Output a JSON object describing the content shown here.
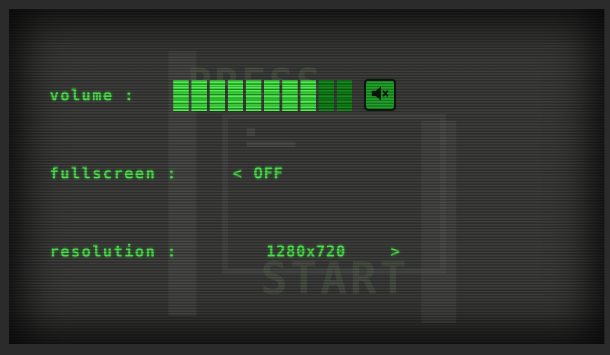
{
  "settings": {
    "volume": {
      "label": "volume :",
      "level": 0.8,
      "segments_total": 10,
      "segments_filled": 8,
      "mute_icon": "speaker-mute-icon"
    },
    "fullscreen": {
      "label": "fullscreen :",
      "value": "OFF",
      "left_arrow": "<"
    },
    "resolution": {
      "label": "resolution :",
      "value": "1280x720",
      "right_arrow": ">"
    }
  },
  "background": {
    "ghost_top": "PRESS",
    "ghost_bottom": "START"
  },
  "colors": {
    "text": "#4fe24f",
    "segment_on": "#4ff04f",
    "segment_off": "#138c1c",
    "screen": "#3d3d3c"
  }
}
